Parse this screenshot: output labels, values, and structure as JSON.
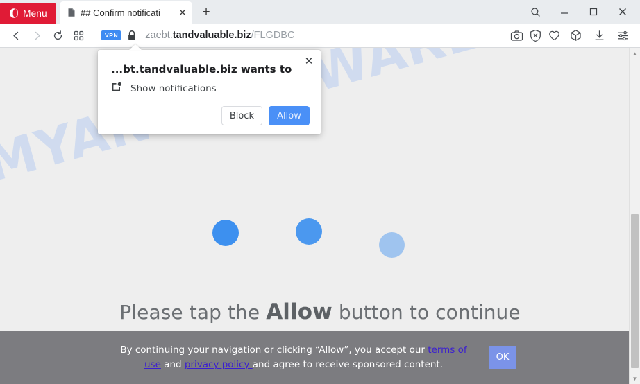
{
  "browser": {
    "menu_button_label": "Menu",
    "menu_icon": "opera-logo-icon",
    "tabs": [
      {
        "title": "## Confirm notificati",
        "favicon": "page-icon",
        "close_glyph": "✕"
      }
    ],
    "new_tab_glyph": "+",
    "window_controls": {
      "search_glyph": "⌕",
      "minimize_glyph": "—",
      "maximize_glyph": "□",
      "close_glyph": "✕"
    },
    "nav": {
      "back_glyph": "‹",
      "forward_glyph": "›",
      "reload_glyph": "⟳",
      "tiles_glyph": "☷",
      "vpn_badge": "VPN",
      "lock_icon": "padlock-icon"
    },
    "address": {
      "prefix": "zaebt.",
      "domain": "tandvaluable.biz",
      "path": "/FLGDBC",
      "full": "zaebt.tandvaluable.biz/FLGDBC"
    },
    "toolbar_icons": [
      {
        "name": "snapshot-camera-icon"
      },
      {
        "name": "ad-blocker-shield-icon"
      },
      {
        "name": "heart-icon"
      },
      {
        "name": "extensions-cube-icon"
      },
      {
        "name": "downloads-icon"
      },
      {
        "name": "easy-setup-sliders-icon"
      }
    ]
  },
  "permission_popup": {
    "title": "...bt.tandvaluable.biz wants to",
    "request_label": "Show notifications",
    "request_icon": "notification-badge-icon",
    "close_glyph": "✕",
    "block_label": "Block",
    "allow_label": "Allow",
    "allow_color": "#4a90f7"
  },
  "page": {
    "watermark": "MYANTISPYWARE.COM",
    "background": "#eeeeee",
    "loading_dots": [
      {
        "color": "#3d90ef",
        "opacity": "1"
      },
      {
        "color": "#3d90ef",
        "opacity": "0.92"
      },
      {
        "color": "#3d90ef",
        "opacity": "0.45"
      }
    ],
    "tap_line": {
      "before": "Please tap the ",
      "emphasis": "Allow",
      "after": " button to continue"
    },
    "consent": {
      "line1_a": "By continuing your navigation or clicking “Allow”, you accept our ",
      "link_terms": "terms of use",
      "line2_a": " and ",
      "link_privacy": "privacy policy ",
      "line2_b": "and agree to receive sponsored content.",
      "ok_label": "OK",
      "background": "#7c7c80",
      "ok_color": "#7b93e8"
    }
  },
  "scrollbar": {
    "up_glyph": "▲",
    "down_glyph": "▼"
  }
}
